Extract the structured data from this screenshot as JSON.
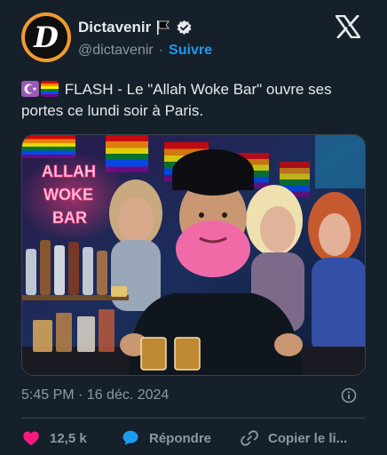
{
  "account": {
    "display_name": "Dictavenir",
    "handle": "@dictavenir",
    "separator": "·",
    "follow_label": "Suivre",
    "avatar_letter": "D",
    "verified": true,
    "flag_emoji": "black-flag-icon"
  },
  "tweet": {
    "text": "FLASH - Le \"Allah Woke Bar\" ouvre ses portes ce lundi soir à Paris.",
    "emojis": [
      "star-and-crescent-icon",
      "rainbow-flag-icon"
    ],
    "timestamp": "5:45 PM · 16 déc. 2024"
  },
  "media": {
    "neon_sign_lines": [
      "ALLAH",
      "WOKE",
      "BAR"
    ]
  },
  "actions": {
    "likes": "12,5 k",
    "reply_label": "Répondre",
    "copy_label": "Copier le li..."
  },
  "colors": {
    "background": "#15202b",
    "accent": "#1d9bf0",
    "like": "#f91880",
    "muted": "#8b98a5"
  }
}
